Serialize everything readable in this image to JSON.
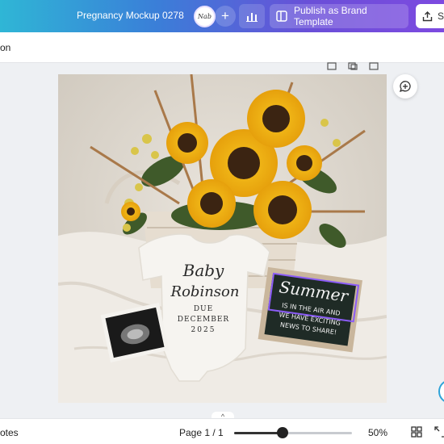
{
  "header": {
    "doc_title": "Pregnancy Mockup 0278",
    "avatar_text": "Nab",
    "publish_label": "Publish as Brand Template",
    "share_label": "S"
  },
  "subbar": {
    "text": "on"
  },
  "design": {
    "onesie_line1": "Baby",
    "onesie_line2": "Robinson",
    "due_label": "DUE",
    "due_month": "DECEMBER",
    "due_year": "2025",
    "board_title": "Summer",
    "board_line1": "IS IN THE AIR AND",
    "board_line2": "WE HAVE EXCITING",
    "board_line3": "NEWS TO SHARE!"
  },
  "footer": {
    "notes_label": "otes",
    "page_indicator": "Page 1 / 1",
    "zoom_label": "50%",
    "zoom_fraction": 0.41
  },
  "colors": {
    "accent": "#7d4ae0",
    "selection": "#8b5cf6",
    "board": "#1f2b26"
  }
}
